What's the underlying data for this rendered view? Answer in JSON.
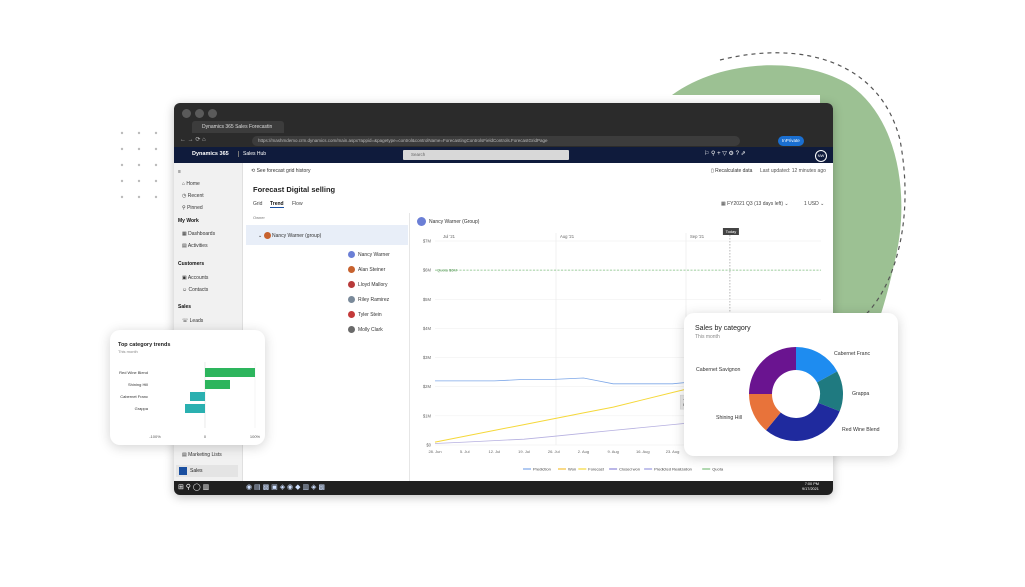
{
  "browser": {
    "tab_title": "Dynamics 365 Sales Forecastin",
    "url": "https://mashmdemo.crm.dynamics.com/main.aspx?appid=&pagetype=control&controlName=ForecastingControlsFieldControls.ForecastGridPage",
    "profile": "InPrivate"
  },
  "app": {
    "brand": "Dynamics 365",
    "app_name": "Sales Hub",
    "search_placeholder": "Search",
    "user_initials": "NW"
  },
  "sidebar": {
    "items": [
      {
        "label": "Home"
      },
      {
        "label": "Recent"
      },
      {
        "label": "Pinned"
      }
    ],
    "my_work": "My Work",
    "my_work_items": [
      {
        "label": "Dashboards"
      },
      {
        "label": "Activities"
      }
    ],
    "customers": "Customers",
    "customers_items": [
      {
        "label": "Accounts"
      },
      {
        "label": "Contacts"
      }
    ],
    "sales": "Sales",
    "sales_items": [
      {
        "label": "Leads"
      }
    ],
    "marketing_lists": "Marketing Lists",
    "area": "Sales"
  },
  "forecast": {
    "history_link": "See forecast grid history",
    "recalculate": "Recalculate data",
    "last_updated": "Last updated: 12 minutes ago",
    "title": "Forecast Digital selling",
    "tabs": [
      "Grid",
      "Trend",
      "Flow"
    ],
    "period": "FY2021 Q3 (13 days left)",
    "currency": "1 USD",
    "owner_label": "Owner",
    "group": "Nancy Warner (group)",
    "chart_header": "Nancy Warner (Group)",
    "people": [
      "Nancy Warner",
      "Alan Steiner",
      "Lloyd Mallory",
      "Riley Ramirez",
      "Tyler Stein",
      "Molly Clark"
    ],
    "month_labels": [
      "Jul '21",
      "Aug '21",
      "Sep '21"
    ],
    "today_label": "Today",
    "quota_label": "Quota $6M",
    "tooltip_date": "June 21, 2021",
    "tooltip_text": "Forecast   $1,390,000.00",
    "legend": [
      "Prediction",
      "Won",
      "Forecast",
      "Closed won",
      "Predicted Realization",
      "Quota"
    ]
  },
  "chart_data": {
    "type": "line",
    "x": [
      "28. Jun",
      "5. Jul",
      "12. Jul",
      "19. Jul",
      "26. Jul",
      "2. Aug",
      "9. Aug",
      "16. Aug",
      "23. Aug",
      "30. Aug",
      "6. Sep",
      "13. Sep",
      "20. Sep",
      "27. Sep"
    ],
    "yticks": [
      "$0",
      "$1M",
      "$2M",
      "$3M",
      "$4M",
      "$5M",
      "$6M",
      "$7M"
    ],
    "ylim": [
      0,
      7
    ],
    "series": [
      {
        "name": "Quota",
        "values": [
          6,
          6,
          6,
          6,
          6,
          6,
          6,
          6,
          6,
          6,
          6,
          6,
          6,
          6
        ],
        "color": "#7fbf7f"
      },
      {
        "name": "Prediction",
        "values": [
          2.2,
          2.2,
          2.2,
          2.25,
          2.25,
          2.3,
          2.1,
          2.1,
          2.1,
          2.2,
          2.5,
          2.5,
          2.5,
          2.5
        ],
        "color": "#7da7e8"
      },
      {
        "name": "Forecast",
        "values": [
          0.1,
          0.3,
          0.5,
          0.7,
          0.9,
          1.1,
          1.3,
          1.55,
          1.8,
          2.05,
          1.2,
          1.35,
          1.35,
          1.35
        ],
        "color": "#f5d83a"
      },
      {
        "name": "Closed won",
        "values": [
          0.05,
          0.1,
          0.15,
          0.2,
          0.3,
          0.4,
          0.5,
          0.6,
          0.7,
          0.8,
          1.2,
          1.3,
          1.35,
          1.35
        ],
        "color": "#b6b0e0"
      }
    ]
  },
  "cards": {
    "top_category": {
      "title": "Top category trends",
      "subtitle": "This month",
      "categories": [
        "Red Wine Blend",
        "Shining Hill",
        "Cabernet Franc",
        "Grappa"
      ],
      "values": [
        100,
        50,
        -30,
        -40
      ],
      "axis": [
        "-100%",
        "0",
        "100%"
      ],
      "colors": [
        "#2db55d",
        "#2db55d",
        "#2ab0b0",
        "#2ab0b0"
      ]
    },
    "sales_by_category": {
      "title": "Sales by category",
      "subtitle": "This month",
      "slices": [
        {
          "label": "Cabernet Franc",
          "value": 17,
          "color": "#1e8cf0"
        },
        {
          "label": "Grappa",
          "value": 14,
          "color": "#1f7a80"
        },
        {
          "label": "Red Wine Blend",
          "value": 30,
          "color": "#1f2a9e"
        },
        {
          "label": "Shining Hill",
          "value": 14,
          "color": "#e8733a"
        },
        {
          "label": "Cabernet Savignon",
          "value": 25,
          "color": "#6a1490"
        }
      ]
    }
  },
  "taskbar": {
    "time": "7:00 PM",
    "date": "9/17/2021"
  }
}
